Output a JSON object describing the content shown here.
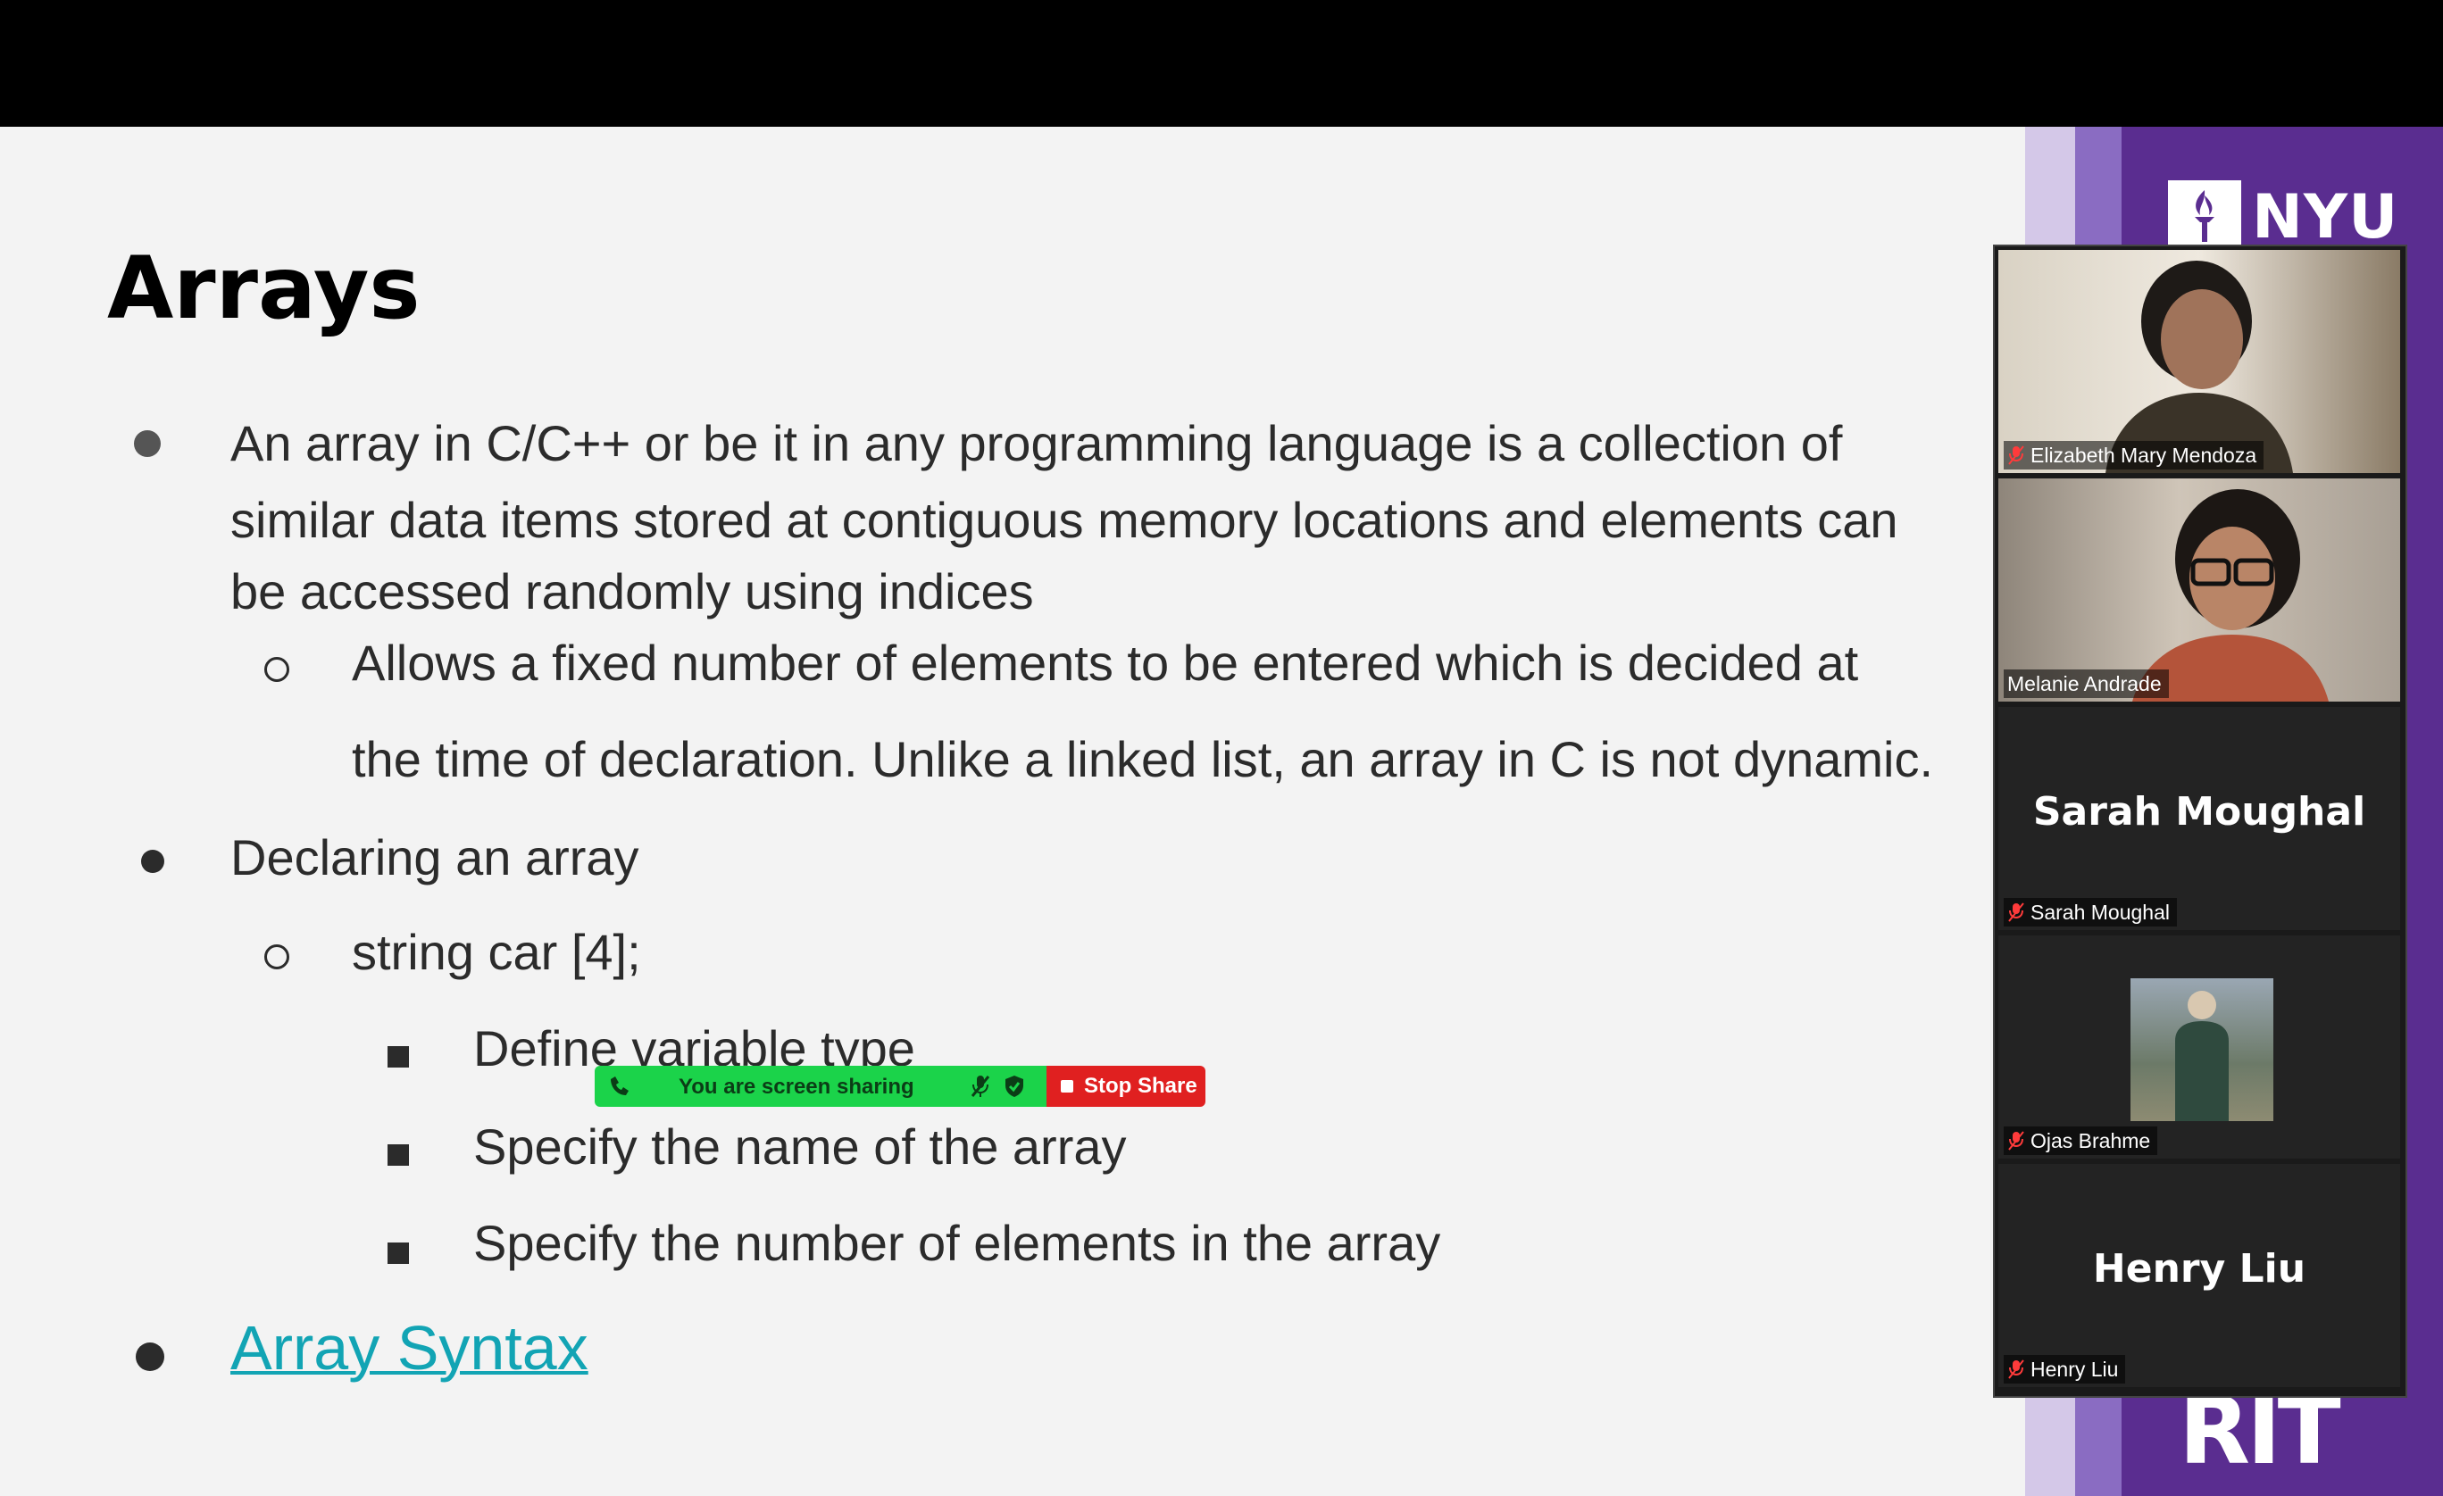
{
  "slide": {
    "title": "Arrays",
    "bullet1_lines": [
      "An array in C/C++ or be it in any programming language is a collection of",
      "similar data items stored at contiguous memory locations and elements can",
      "be accessed randomly using indices"
    ],
    "sub1_lines": [
      "Allows a fixed number of elements to be entered which is decided at",
      "the time of declaration. Unlike a linked list, an array in C is not dynamic."
    ],
    "bullet2": "Declaring an array",
    "sub2": "string car [4];",
    "subsub": [
      "Define variable type",
      "Specify the name of the array",
      "Specify the number of elements in the array"
    ],
    "link_text": "Array Syntax",
    "logo_top": "NYU",
    "logo_bottom": "RIT"
  },
  "share_bar": {
    "status_text": "You are screen sharing",
    "stop_label": "Stop Share"
  },
  "participants": [
    {
      "name": "Elizabeth Mary Mendoza",
      "video": true,
      "muted": true,
      "speaking": false
    },
    {
      "name": "Melanie Andrade",
      "video": true,
      "muted": false,
      "speaking": true
    },
    {
      "name": "Sarah Moughal",
      "big_name": "Sarah Moughal",
      "video": false,
      "muted": true,
      "speaking": false
    },
    {
      "name": "Ojas Brahme",
      "video": false,
      "avatar_photo": true,
      "muted": true,
      "speaking": false
    },
    {
      "name": "Henry Liu",
      "big_name": "Henry Liu",
      "video": false,
      "muted": true,
      "speaking": false
    }
  ],
  "colors": {
    "link": "#12a4b4",
    "share_green": "#1bd34a",
    "stop_red": "#e02020",
    "nyu_purple": "#5a2d90",
    "active_speaker": "#9be03a"
  }
}
